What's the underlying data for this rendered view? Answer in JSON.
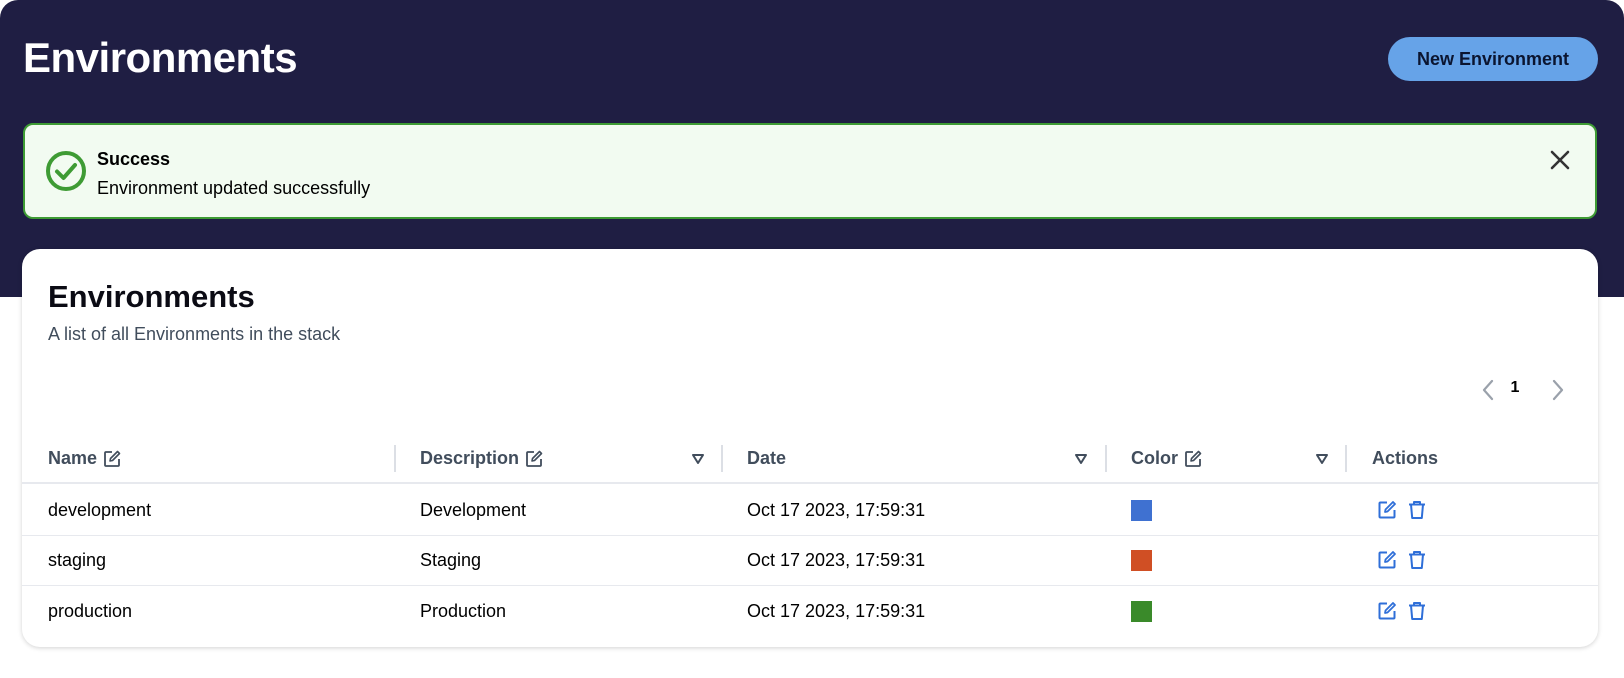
{
  "header": {
    "title": "Environments",
    "new_button_label": "New Environment"
  },
  "flash": {
    "type": "success",
    "title": "Success",
    "message": "Environment updated successfully",
    "icon": "check-circle-icon",
    "close_icon": "close-icon"
  },
  "card": {
    "title": "Environments",
    "subtitle": "A list of all Environments in the stack"
  },
  "pagination": {
    "current_page": "1"
  },
  "table": {
    "columns": [
      {
        "label": "Name",
        "editable": true,
        "sortable": false
      },
      {
        "label": "Description",
        "editable": true,
        "sortable": true
      },
      {
        "label": "Date",
        "editable": false,
        "sortable": true
      },
      {
        "label": "Color",
        "editable": true,
        "sortable": true
      },
      {
        "label": "Actions",
        "editable": false,
        "sortable": false
      }
    ],
    "rows": [
      {
        "name": "development",
        "description": "Development",
        "date": "Oct 17 2023, 17:59:31",
        "color": "#3f71d1"
      },
      {
        "name": "staging",
        "description": "Staging",
        "date": "Oct 17 2023, 17:59:31",
        "color": "#d04f24"
      },
      {
        "name": "production",
        "description": "Production",
        "date": "Oct 17 2023, 17:59:31",
        "color": "#3a8a2a"
      }
    ]
  },
  "colors": {
    "header_bg": "#1f1e43",
    "accent": "#66a3e8",
    "success": "#3e9b34",
    "action_icon": "#2f6fd8"
  }
}
